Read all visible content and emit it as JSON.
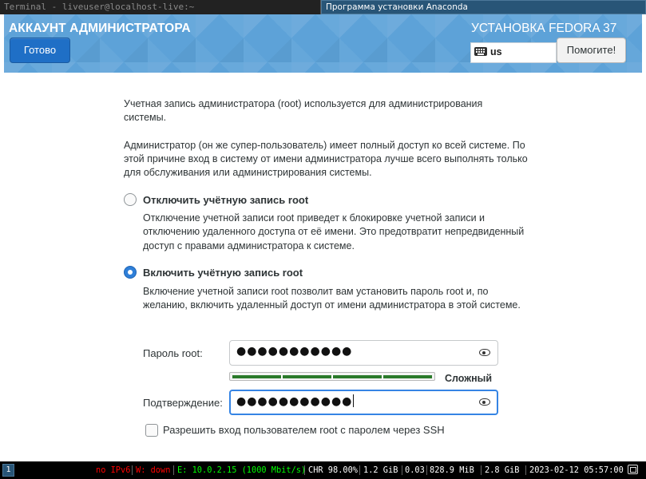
{
  "window_tabs": [
    {
      "label": "Terminal - liveuser@localhost-live:~"
    },
    {
      "label": "Программа установки Anaconda"
    }
  ],
  "header": {
    "title": "АККАУНТ АДМИНИСТРАТОРА",
    "done_label": "Готово",
    "product": "УСТАНОВКА FEDORA 37",
    "keyboard_layout": "us",
    "help_label": "Помогите!"
  },
  "content": {
    "intro_1": "Учетная запись администратора (root) используется для администрирования системы.",
    "intro_2": "Администратор (он же супер-пользователь) имеет полный доступ ко всей системе. По этой причине вход в систему от имени администратора лучше всего выполнять только для обслуживания или администрирования системы.",
    "option_disable": {
      "title": "Отключить учётную запись root",
      "description": "Отключение учетной записи root приведет к блокировке учетной записи и отключению удаленного доступа от её имени. Это предотвратит непредвиденный доступ с правами администратора к системе.",
      "selected": false
    },
    "option_enable": {
      "title": "Включить учётную запись root",
      "description": "Включение учетной записи root позволит вам установить пароль root и, по желанию, включить удаленный доступ от имени администратора в этой системе.",
      "selected": true
    },
    "password_label": "Пароль root:",
    "password_value": "●●●●●●●●●●●",
    "strength_fraction": 1.0,
    "strength_label": "Сложный",
    "confirm_label": "Подтверждение:",
    "confirm_value": "●●●●●●●●●●●",
    "ssh_checkbox_label": "Разрешить вход пользователем root с паролем через SSH",
    "ssh_checkbox_checked": false
  },
  "statusbar": {
    "workspace": "1",
    "ipv6": "no IPv6",
    "wifi": "W: down",
    "ethernet": "E: 10.0.2.15 (1000 Mbit/s)",
    "chr": "CHR 98.00%",
    "disk": "1.2 GiB",
    "load": "0.03",
    "mem": "828.9 MiB",
    "swap": "2.8 GiB",
    "datetime": "2023-02-12 05:57:00"
  },
  "colors": {
    "header_blue": "#5da2d8",
    "primary_button": "#1f6fc6",
    "strength_green": "#2b7a2b",
    "status_red": "#ff0000",
    "status_green": "#00ff00"
  }
}
